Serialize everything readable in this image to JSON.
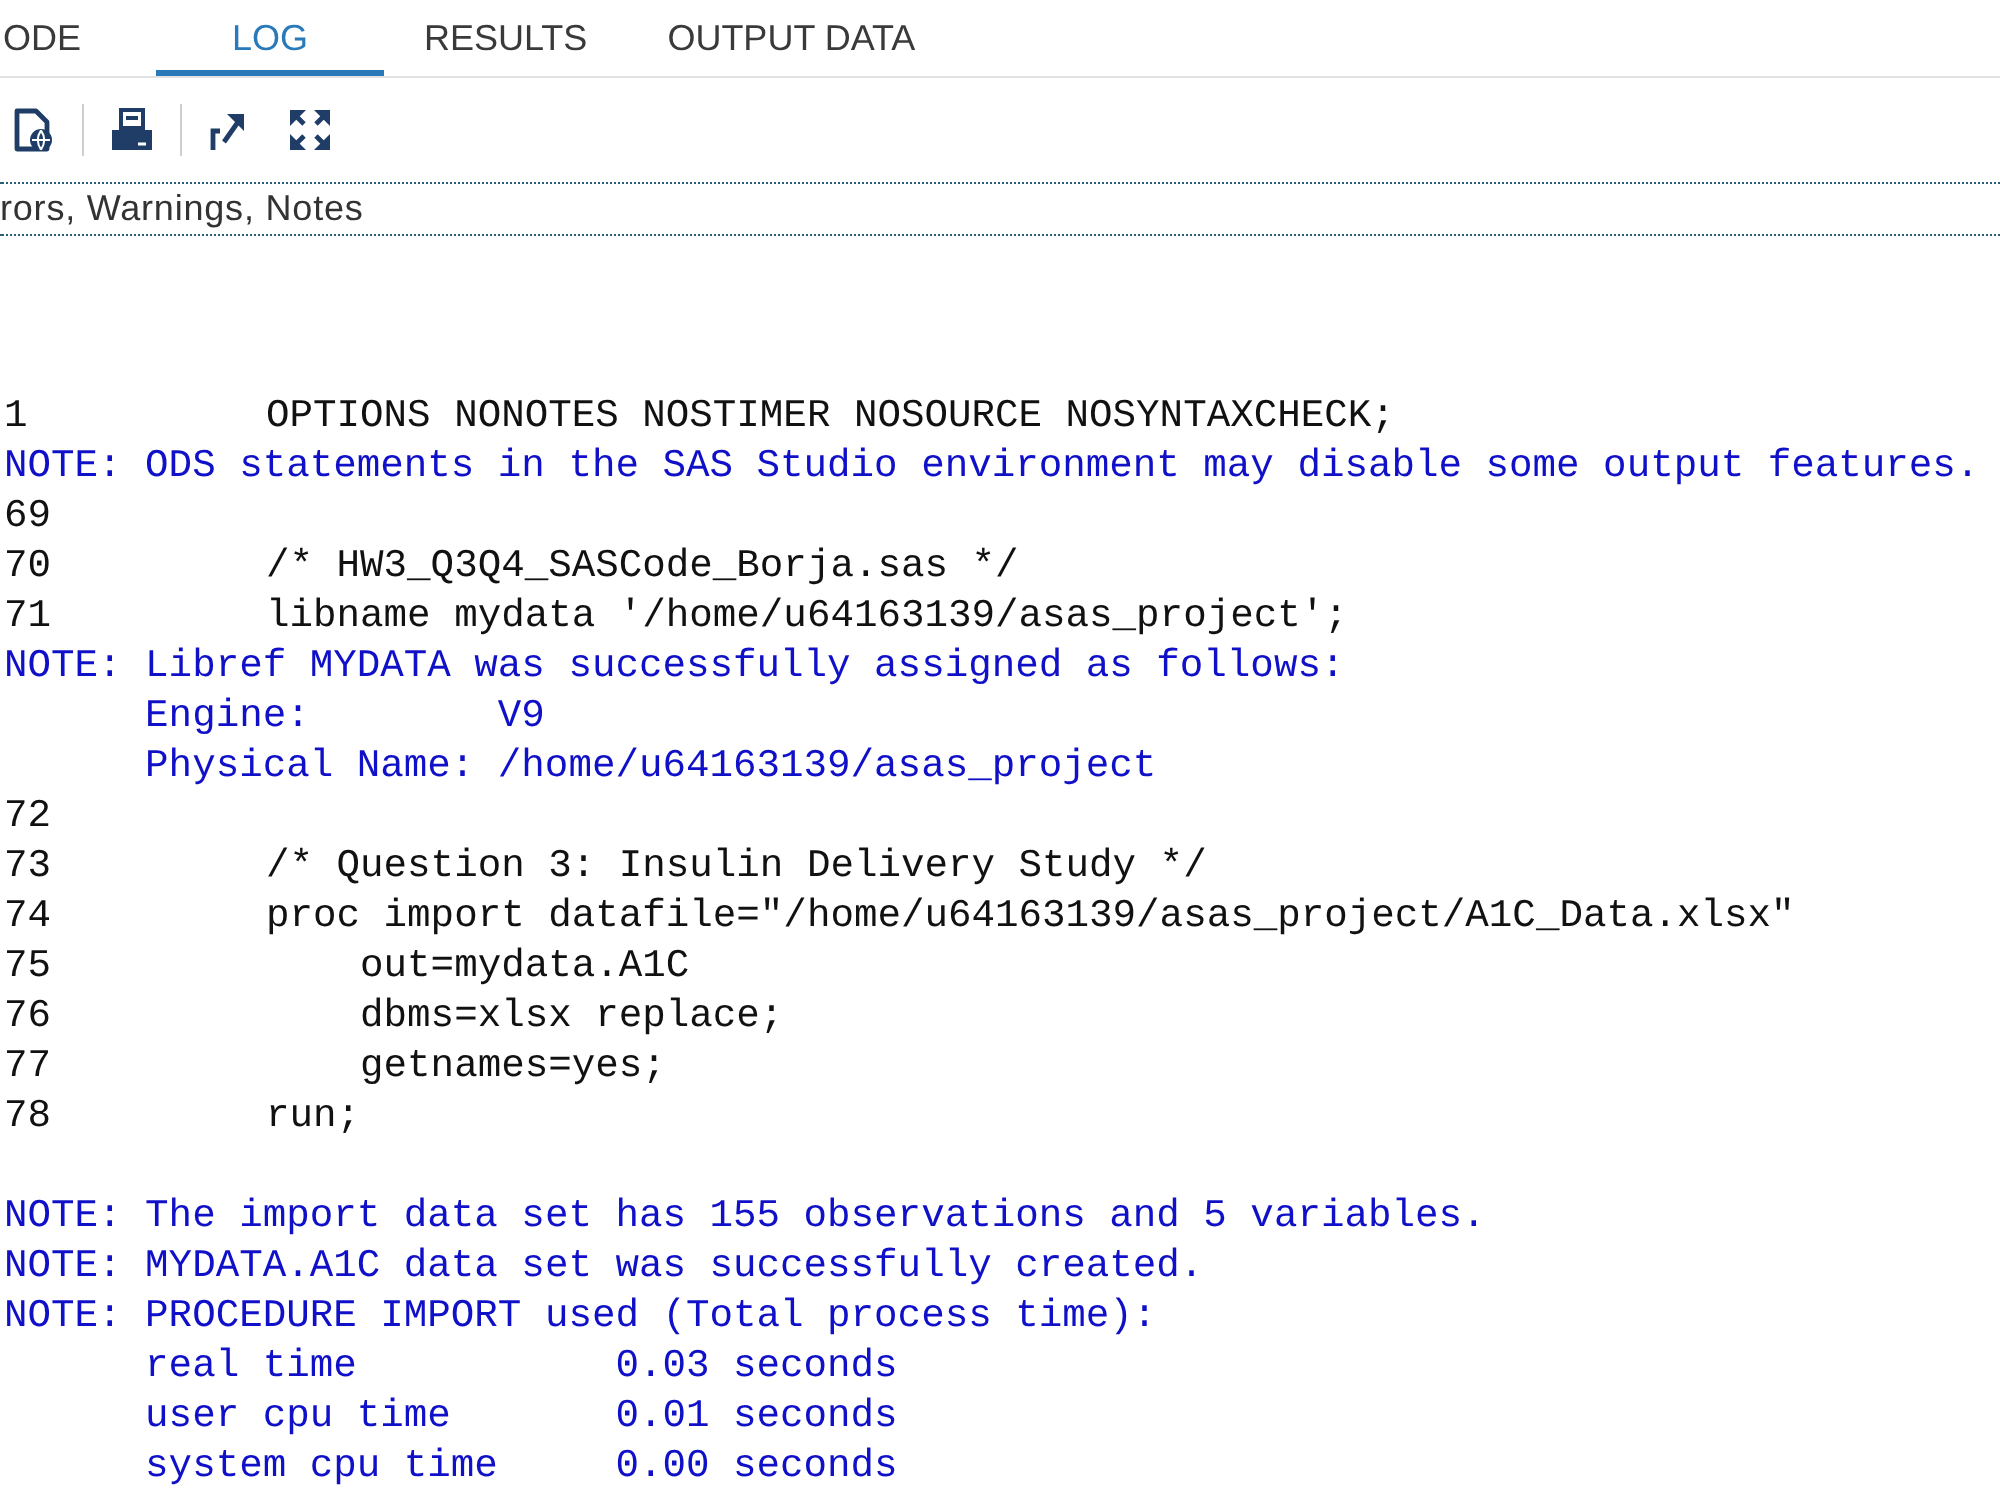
{
  "tabs": [
    {
      "label": "ODE",
      "selected": false
    },
    {
      "label": "LOG",
      "selected": true
    },
    {
      "label": "RESULTS",
      "selected": false
    },
    {
      "label": "OUTPUT DATA",
      "selected": false
    }
  ],
  "section_header": {
    "label": "rors, Warnings, Notes"
  },
  "log": {
    "blocks": [
      {
        "lines": [
          {
            "kind": "source",
            "number": "1",
            "text": "OPTIONS NONOTES NOSTIMER NOSOURCE NOSYNTAXCHECK;"
          },
          {
            "kind": "note",
            "text": "NOTE: ODS statements in the SAS Studio environment may disable some output features."
          },
          {
            "kind": "source",
            "number": "69"
          },
          {
            "kind": "source",
            "number": "70",
            "text": "/* HW3_Q3Q4_SASCode_Borja.sas */"
          },
          {
            "kind": "source",
            "number": "71",
            "text": "libname mydata '/home/u64163139/asas_project';"
          },
          {
            "kind": "note",
            "text": "NOTE: Libref MYDATA was successfully assigned as follows:",
            "children": [
              {
                "kind": "note",
                "text": "Engine:        V9"
              },
              {
                "kind": "note",
                "text": "Physical Name: /home/u64163139/asas_project"
              }
            ]
          },
          {
            "kind": "source",
            "number": "72"
          },
          {
            "kind": "source",
            "number": "73",
            "text": "/* Question 3: Insulin Delivery Study */"
          },
          {
            "kind": "source",
            "number": "74",
            "text": "proc import datafile=\"/home/u64163139/asas_project/A1C_Data.xlsx\"",
            "children": [
              {
                "kind": "source",
                "number": "75",
                "text": "out=mydata.A1C"
              },
              {
                "kind": "source",
                "number": "76",
                "text": "dbms=xlsx replace;"
              },
              {
                "kind": "source",
                "number": "77",
                "text": "getnames=yes;"
              }
            ]
          },
          {
            "kind": "source",
            "number": "78",
            "text": "run;"
          }
        ]
      },
      {
        "lines": [
          {
            "kind": "note",
            "text": "NOTE: The import data set has 155 observations and 5 variables."
          },
          {
            "kind": "note",
            "text": "NOTE: MYDATA.A1C data set was successfully created."
          },
          {
            "kind": "note",
            "text": "NOTE: PROCEDURE IMPORT used (Total process time):",
            "children": [
              {
                "kind": "note",
                "text": "real time           0.03 seconds"
              },
              {
                "kind": "note",
                "text": "user cpu time       0.01 seconds"
              },
              {
                "kind": "note",
                "text": "system cpu time     0.00 seconds"
              }
            ]
          }
        ]
      }
    ]
  }
}
